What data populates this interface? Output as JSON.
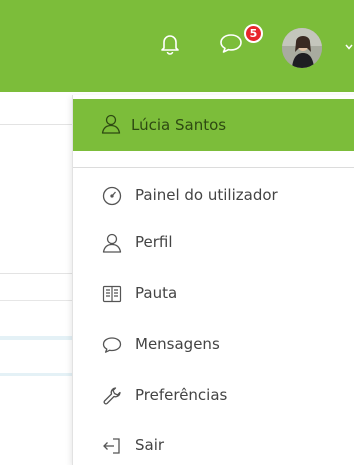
{
  "navbar": {
    "notifications_icon": "bell-icon",
    "messages_icon": "chat-bubble-icon",
    "messages_badge": "5",
    "avatar": "user-avatar",
    "user_menu_caret": "chevron-down-icon",
    "colors": {
      "brand_green": "#7cbd3a",
      "badge_red": "#e8262b"
    }
  },
  "user_menu": {
    "header": {
      "label": "Lúcia Santos",
      "icon": "user-icon"
    },
    "items": [
      {
        "label": "Painel do utilizador",
        "icon": "gauge-icon"
      },
      {
        "label": "Perfil",
        "icon": "user-icon"
      },
      {
        "label": "Pauta",
        "icon": "book-icon"
      },
      {
        "label": "Mensagens",
        "icon": "chat-bubble-icon"
      },
      {
        "label": "Preferências",
        "icon": "wrench-icon"
      },
      {
        "label": "Sair",
        "icon": "sign-out-icon"
      }
    ]
  }
}
